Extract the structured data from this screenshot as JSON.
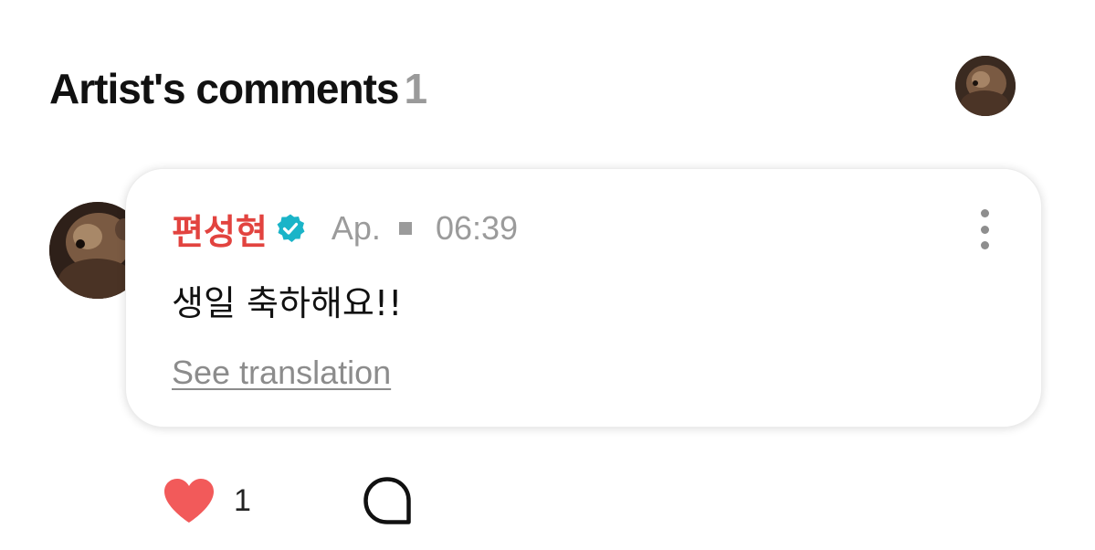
{
  "header": {
    "title": "Artist's comments",
    "count": "1",
    "avatar_icon": "profile-avatar-icon"
  },
  "comment": {
    "author": "편성현",
    "verified_icon": "verified-badge-icon",
    "date": "Ap.",
    "time": "06:39",
    "text": "생일 축하해요!!",
    "see_translation_label": "See translation",
    "more_icon": "more-vertical-icon"
  },
  "actions": {
    "like_count": "1",
    "like_icon": "heart-icon",
    "reply_icon": "comment-bubble-icon"
  },
  "colors": {
    "author": "#e2433f",
    "verified": "#1ab4c8",
    "heart": "#f25a5a",
    "muted": "#9b9b9b"
  }
}
